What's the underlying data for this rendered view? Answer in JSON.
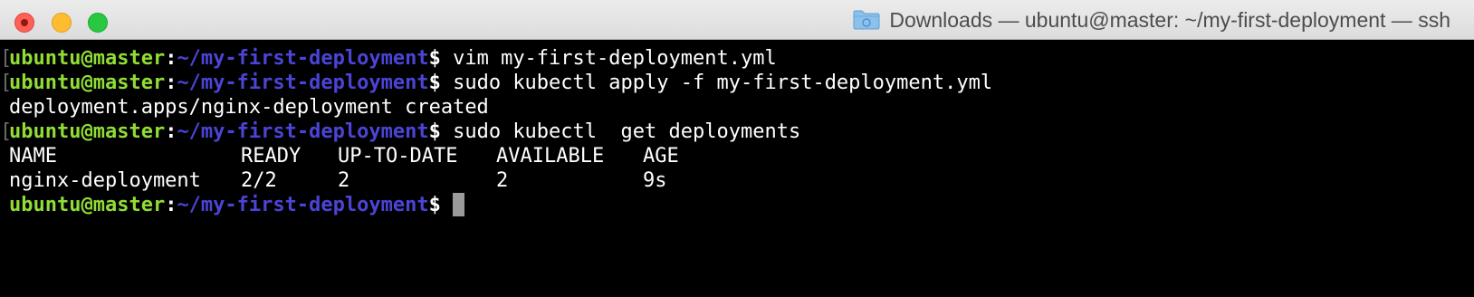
{
  "window": {
    "title": "Downloads — ubuntu@master: ~/my-first-deployment — ssh",
    "title_icon": "folder-icon",
    "traffic_lights": {
      "close": "#fe5f57",
      "minimize": "#febc2e",
      "maximize": "#28c840"
    }
  },
  "prompt": {
    "user_host": "ubuntu@master",
    "separator": ":",
    "path": "~/my-first-deployment",
    "symbol": "$"
  },
  "colors": {
    "user": "#8fdd35",
    "path": "#4b44d6",
    "background": "#000000",
    "text": "#ffffff"
  },
  "lines": {
    "l1_cmd": " vim my-first-deployment.yml",
    "l2_cmd": " sudo kubectl apply -f my-first-deployment.yml",
    "l3_output": "deployment.apps/nginx-deployment created",
    "l4_cmd": " sudo kubectl  get deployments",
    "table": {
      "headers": [
        "NAME",
        "READY",
        "UP-TO-DATE",
        "AVAILABLE",
        "AGE"
      ],
      "rows": [
        [
          "nginx-deployment",
          "2/2",
          "2",
          "2",
          "9s"
        ]
      ]
    }
  },
  "bracket": "["
}
